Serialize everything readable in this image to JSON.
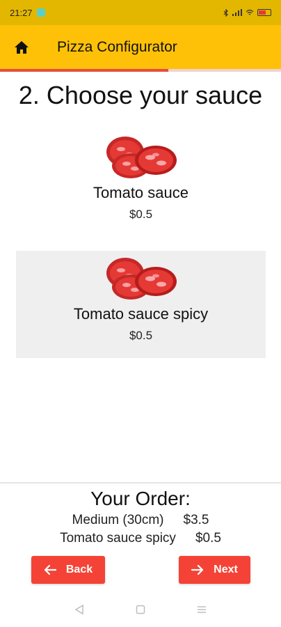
{
  "status": {
    "time": "21:27",
    "signal": "★ % •• ••"
  },
  "app_bar": {
    "title": "Pizza Configurator",
    "home_icon": "home-icon"
  },
  "progress": {
    "fraction": 0.6
  },
  "step_title": "2. Choose your sauce",
  "sauces": [
    {
      "name": "Tomato sauce",
      "price": "$0.5",
      "selected": false
    },
    {
      "name": "Tomato sauce spicy",
      "price": "$0.5",
      "selected": true
    }
  ],
  "order": {
    "heading": "Your Order:",
    "lines": [
      {
        "item": "Medium (30cm)",
        "price": "$3.5"
      },
      {
        "item": "Tomato sauce spicy",
        "price": "$0.5"
      }
    ]
  },
  "buttons": {
    "back_label": "Back",
    "next_label": "Next"
  },
  "colors": {
    "primary": "#ffc107",
    "accent": "#f44336",
    "status_bar": "#e3b700",
    "selected_card": "#efefef"
  }
}
